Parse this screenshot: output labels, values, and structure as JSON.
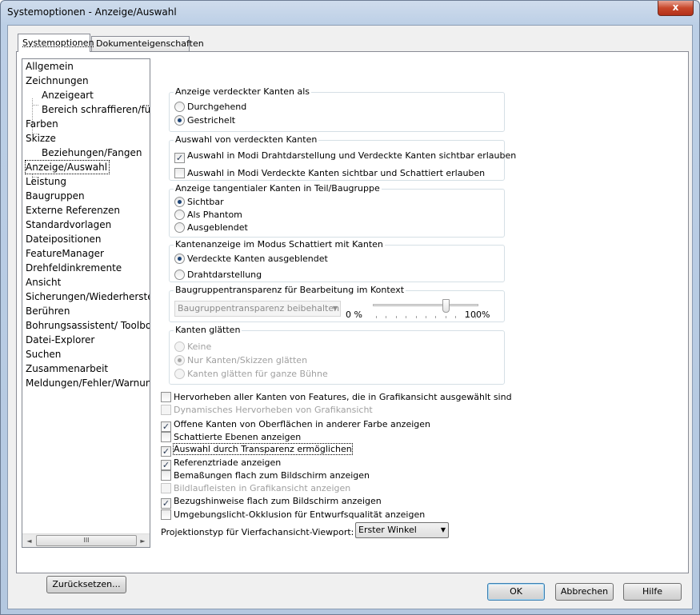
{
  "window": {
    "title": "Systemoptionen - Anzeige/Auswahl",
    "close_glyph": "x"
  },
  "tabs": [
    {
      "label": "Systemoptionen",
      "active": true
    },
    {
      "label": "Dokumenteigenschaften",
      "active": false
    }
  ],
  "tree": {
    "items": [
      {
        "label": "Allgemein",
        "level": 0
      },
      {
        "label": "Zeichnungen",
        "level": 0
      },
      {
        "label": "Anzeigeart",
        "level": 1
      },
      {
        "label": "Bereich schraffieren/füller",
        "level": 1
      },
      {
        "label": "Farben",
        "level": 0
      },
      {
        "label": "Skizze",
        "level": 0
      },
      {
        "label": "Beziehungen/Fangen",
        "level": 1
      },
      {
        "label": "Anzeige/Auswahl",
        "level": 0,
        "selected": true
      },
      {
        "label": "Leistung",
        "level": 0
      },
      {
        "label": "Baugruppen",
        "level": 0
      },
      {
        "label": "Externe Referenzen",
        "level": 0
      },
      {
        "label": "Standardvorlagen",
        "level": 0
      },
      {
        "label": "Dateipositionen",
        "level": 0
      },
      {
        "label": "FeatureManager",
        "level": 0
      },
      {
        "label": "Drehfeldinkremente",
        "level": 0
      },
      {
        "label": "Ansicht",
        "level": 0
      },
      {
        "label": "Sicherungen/Wiederherstellen",
        "level": 0
      },
      {
        "label": "Berühren",
        "level": 0
      },
      {
        "label": "Bohrungsassistent/ Toolbox",
        "level": 0
      },
      {
        "label": "Datei-Explorer",
        "level": 0
      },
      {
        "label": "Suchen",
        "level": 0
      },
      {
        "label": "Zusammenarbeit",
        "level": 0
      },
      {
        "label": "Meldungen/Fehler/Warnungen",
        "level": 0
      }
    ],
    "scroll_left": "◄",
    "scroll_thumb": "III",
    "scroll_right": "►"
  },
  "reset_button": "Zurücksetzen...",
  "groups": {
    "hidden_edges": {
      "legend": "Anzeige verdeckter Kanten als",
      "options": [
        {
          "label": "Durchgehend",
          "checked": false
        },
        {
          "label": "Gestrichelt",
          "checked": true
        }
      ]
    },
    "select_hidden": {
      "legend": "Auswahl von verdeckten Kanten",
      "options": [
        {
          "label": "Auswahl in Modi Drahtdarstellung und Verdeckte Kanten sichtbar erlauben",
          "checked": true
        },
        {
          "label": "Auswahl in Modi Verdeckte Kanten sichtbar und Schattiert erlauben",
          "checked": false
        }
      ]
    },
    "tangent": {
      "legend": "Anzeige tangentialer Kanten in Teil/Baugruppe",
      "options": [
        {
          "label": "Sichtbar",
          "checked": true
        },
        {
          "label": "Als Phantom",
          "checked": false
        },
        {
          "label": "Ausgeblendet",
          "checked": false
        }
      ]
    },
    "shaded_edges": {
      "legend": "Kantenanzeige im Modus Schattiert mit Kanten",
      "options": [
        {
          "label": "Verdeckte Kanten ausgeblendet",
          "checked": true
        },
        {
          "label": "Drahtdarstellung",
          "checked": false
        }
      ]
    },
    "transparency": {
      "legend": "Baugruppentransparenz für Bearbeitung im Kontext",
      "combo_value": "Baugruppentransparenz beibehalten",
      "min_label": "0 %",
      "max_label": "100%",
      "slider_value_pct": 70
    },
    "smoothing": {
      "legend": "Kanten glätten",
      "options": [
        {
          "label": "Keine",
          "checked": false
        },
        {
          "label": "Nur Kanten/Skizzen glätten",
          "checked": true
        },
        {
          "label": "Kanten glätten für ganze Bühne",
          "checked": false
        }
      ]
    }
  },
  "checkboxes": [
    {
      "label": "Hervorheben aller Kanten von Features, die in Grafikansicht ausgewählt sind",
      "checked": false,
      "disabled": false
    },
    {
      "label": "Dynamisches Hervorheben von Grafikansicht",
      "checked": false,
      "disabled": true
    },
    {
      "label": "Offene Kanten von Oberflächen in anderer Farbe anzeigen",
      "checked": true,
      "disabled": false
    },
    {
      "label": "Schattierte Ebenen anzeigen",
      "checked": false,
      "disabled": false
    },
    {
      "label": "Auswahl durch Transparenz ermöglichen",
      "checked": true,
      "disabled": false,
      "focused": true
    },
    {
      "label": "Referenztriade anzeigen",
      "checked": true,
      "disabled": false
    },
    {
      "label": "Bemaßungen flach zum Bildschirm anzeigen",
      "checked": false,
      "disabled": false
    },
    {
      "label": "Bildlaufleisten in Grafikansicht anzeigen",
      "checked": false,
      "disabled": true
    },
    {
      "label": "Bezugshinweise flach zum Bildschirm anzeigen",
      "checked": true,
      "disabled": false
    },
    {
      "label": "Umgebungslicht-Okklusion für Entwurfsqualität anzeigen",
      "checked": false,
      "disabled": false
    }
  ],
  "projection": {
    "label": "Projektionstyp für Vierfachansicht-Viewport:",
    "value": "Erster Winkel"
  },
  "footer": {
    "ok": "OK",
    "cancel": "Abbrechen",
    "help": "Hilfe"
  },
  "check_glyph": "✓",
  "dropdown_glyph": "▼"
}
